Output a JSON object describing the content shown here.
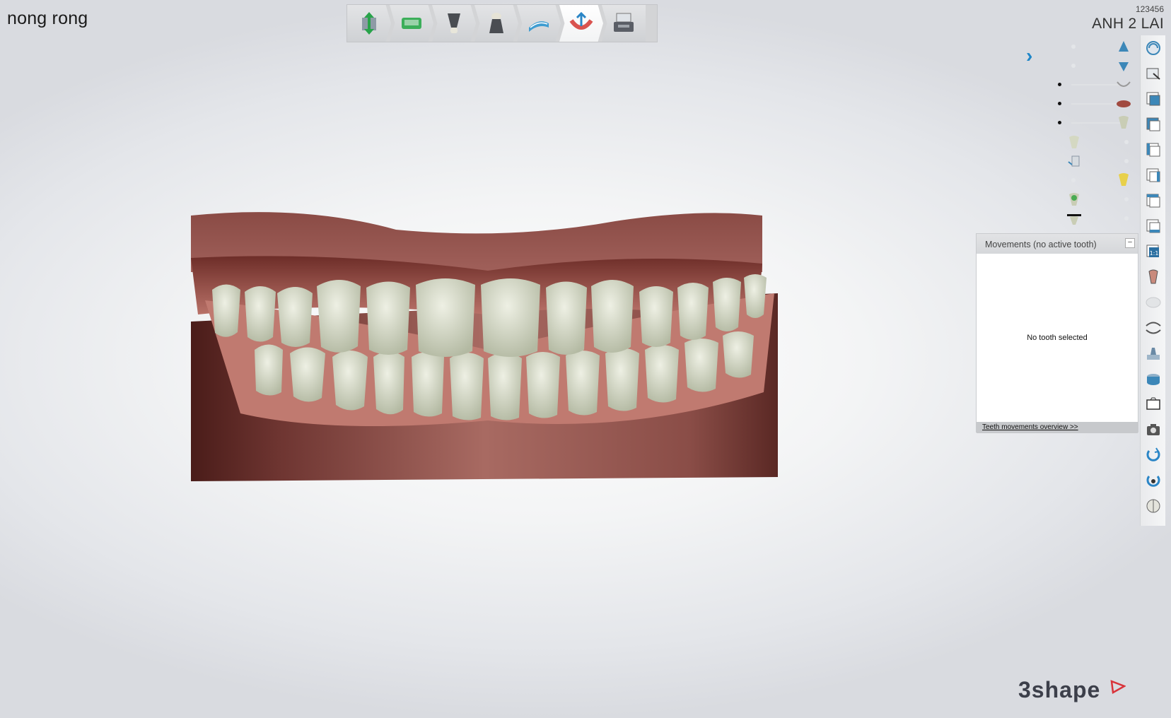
{
  "header": {
    "patient_name": "nong rong",
    "order_id": "123456",
    "case_title": "ANH 2 LAI"
  },
  "workflow": {
    "steps": [
      {
        "name": "scan-icon",
        "active": false
      },
      {
        "name": "model-icon",
        "active": false
      },
      {
        "name": "die-icon",
        "active": false
      },
      {
        "name": "crown-icon",
        "active": false
      },
      {
        "name": "arch-icon",
        "active": false
      },
      {
        "name": "ortho-setup-icon",
        "active": true
      },
      {
        "name": "print-icon",
        "active": false
      }
    ]
  },
  "movements_panel": {
    "title": "Movements (no active tooth)",
    "minimize_label": "–",
    "body_text": "No tooth selected",
    "footer_link": "Teeth movements overview >>"
  },
  "tools": [
    "rotate-view-icon",
    "pan-view-icon",
    "view-front-icon",
    "view-back-icon",
    "view-left-icon",
    "view-right-icon",
    "view-top-icon",
    "view-bottom-icon",
    "zoom-1to1-icon",
    "tooth-select-icon",
    "gum-icon",
    "occlusion-icon",
    "tooth-tool-icon",
    "model-base-icon",
    "screenshot-icon",
    "camera-icon",
    "undo-icon",
    "reset-view-icon",
    "visibility-icon"
  ],
  "colors": {
    "accent": "#1f86c8",
    "gum": "#b86e64",
    "base": "#7a3f3a",
    "tooth": "#d8dccb"
  },
  "logo": {
    "text": "3shape"
  }
}
